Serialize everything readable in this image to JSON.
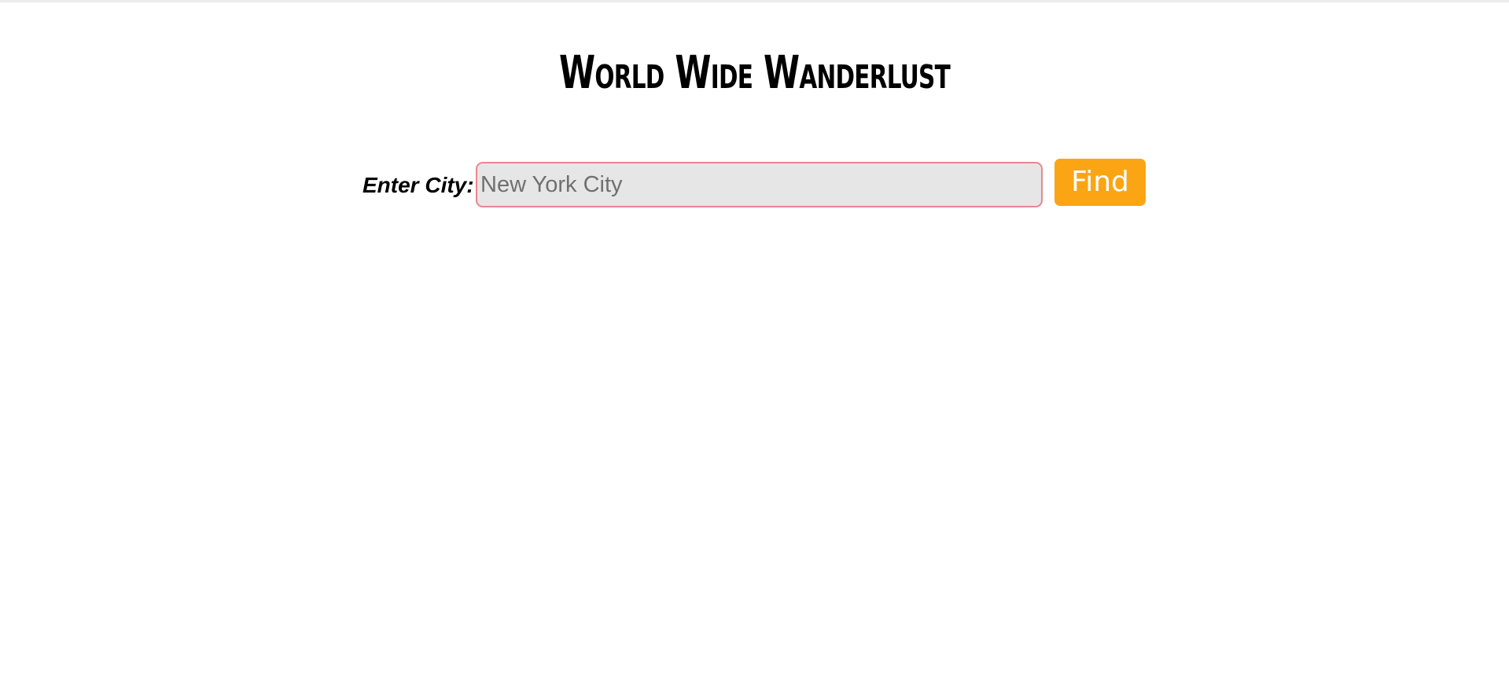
{
  "header": {
    "title": "World Wide Wanderlust"
  },
  "search": {
    "label": "Enter City:",
    "placeholder": "New York City",
    "value": "",
    "button_label": "Find"
  },
  "colors": {
    "button_background": "#fba514",
    "input_background": "#e6e6e6",
    "input_border": "#e88690"
  }
}
